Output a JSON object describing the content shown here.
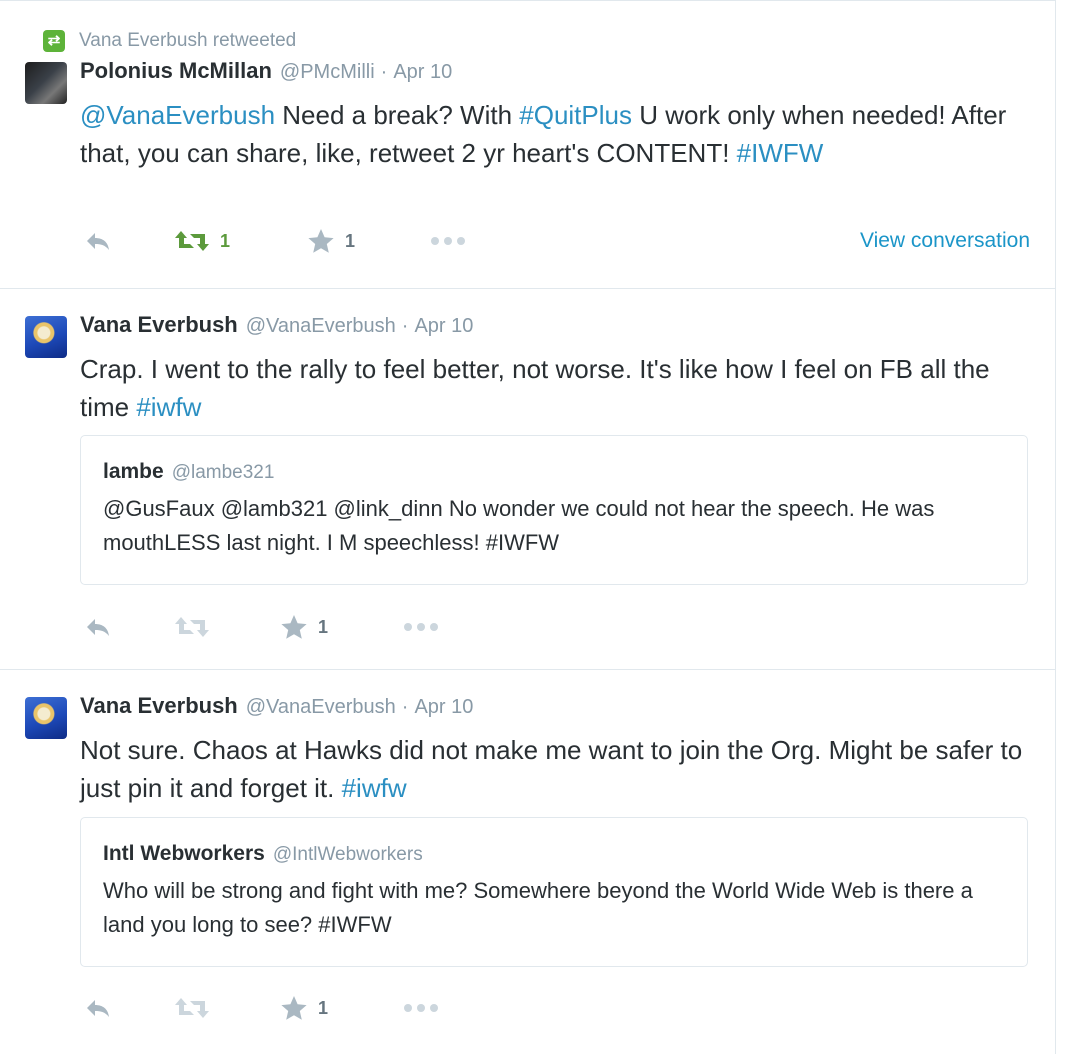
{
  "tweets": [
    {
      "context": "Vana Everbush retweeted",
      "fullname": "Polonius McMillan",
      "handle": "@PMcMilli",
      "separator": "·",
      "time": "Apr 10",
      "text_parts": [
        {
          "t": "@VanaEverbush",
          "link": true
        },
        {
          "t": " Need a break? With "
        },
        {
          "t": "#QuitPlus",
          "link": true
        },
        {
          "t": " U work only when needed! After that, you can share, like, retweet 2 yr heart's CONTENT! "
        },
        {
          "t": "#IWFW",
          "link": true
        }
      ],
      "retweet_count": "1",
      "favorite_count": "1",
      "view_conversation": "View conversation"
    },
    {
      "fullname": "Vana Everbush",
      "handle": "@VanaEverbush",
      "separator": "·",
      "time": "Apr 10",
      "text_parts": [
        {
          "t": "Crap. I went to the rally to feel better, not worse. It's like how I feel on FB all the time "
        },
        {
          "t": "#iwfw",
          "link": true
        }
      ],
      "quote": {
        "name": "lambe",
        "handle": "@lambe321",
        "text": "@GusFaux @lamb321 @link_dinn No wonder we could not hear the speech. He was mouthLESS last night. I M speechless! #IWFW"
      },
      "favorite_count": "1"
    },
    {
      "fullname": "Vana Everbush",
      "handle": "@VanaEverbush",
      "separator": "·",
      "time": "Apr 10",
      "text_parts": [
        {
          "t": "Not sure. Chaos at Hawks did not make me want to join the Org. Might be safer to just pin it and forget it.  "
        },
        {
          "t": "#iwfw",
          "link": true
        }
      ],
      "quote": {
        "name": "Intl Webworkers",
        "handle": "@IntlWebworkers",
        "text": "Who will be strong and fight with me? Somewhere beyond the World Wide Web is there a land you long to see? #IWFW"
      },
      "favorite_count": "1"
    }
  ],
  "colors": {
    "link": "#2b8fc2",
    "retweeted_green": "#5c9a3c",
    "icon_gray": "#aab8c2",
    "muted_text": "#8899a6",
    "border": "#e1e8ed"
  },
  "icons": {
    "reply": "reply-icon",
    "retweet": "retweet-icon",
    "favorite": "star-icon",
    "more": "more-dots-icon"
  }
}
